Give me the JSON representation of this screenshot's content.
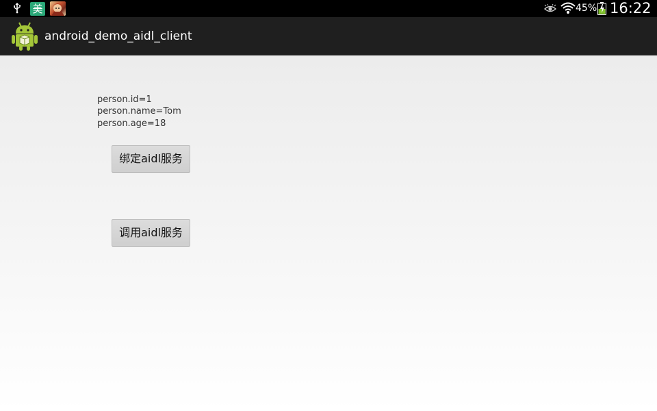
{
  "status_bar": {
    "notification_icons": [
      "usb-icon",
      "mei-icon",
      "game-icon"
    ],
    "mei_glyph": "美",
    "battery_percent": "45%",
    "time": "16:22",
    "right_icons": [
      "eye-icon",
      "wifi-icon",
      "battery-icon"
    ]
  },
  "action_bar": {
    "app_icon": "android-icon",
    "title": "android_demo_aidl_client"
  },
  "content": {
    "person_lines": [
      "person.id=1",
      "person.name=Tom",
      "person.age=18"
    ],
    "bind_button_label": "绑定aidl服务",
    "call_button_label": "调用aidl服务"
  },
  "colors": {
    "status_bar_bg": "#000000",
    "action_bar_bg": "#1f1f1f",
    "button_bg": "#d4d4d4",
    "mei_icon_bg": "#2aa878"
  }
}
